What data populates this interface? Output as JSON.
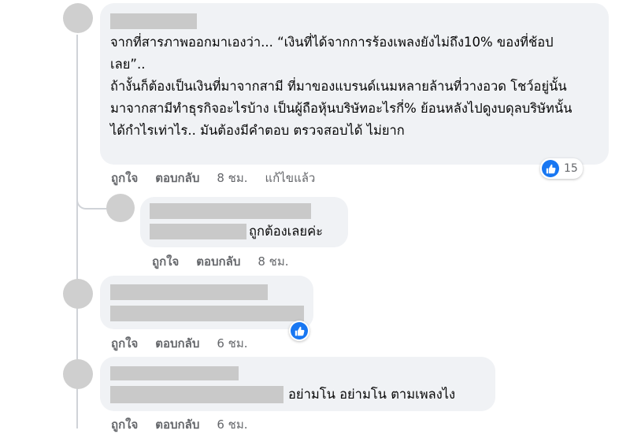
{
  "comments": [
    {
      "text": "จากที่สารภาพออกมาเองว่า... “เงินที่ได้จากการร้องเพลงยังไม่ถึง10% ของที่ช้อปเลย”..\nถ้างั้นก็ต้องเป็นเงินที่มาจากสามี ที่มาของแบรนด์เนมหลายล้านที่วางอวด โชว์อยู่นั้น มาจากสามีทำธุรกิจอะไรบ้าง เป็นผู้ถือหุ้นบริษัทอะไรกี่% ย้อนหลังไปดูงบดุลบริษัทนั้นได้กำไรเท่าไร.. มันต้องมีคำตอบ ตรวจสอบได้ ไม่ยาก",
      "like": "ถูกใจ",
      "reply": "ตอบกลับ",
      "time": "8 ชม.",
      "edited": "แก้ไขแล้ว",
      "reactions": "15"
    },
    {
      "text": "ถูกต้องเลยค่ะ",
      "like": "ถูกใจ",
      "reply": "ตอบกลับ",
      "time": "8 ชม."
    },
    {
      "text": "",
      "like": "ถูกใจ",
      "reply": "ตอบกลับ",
      "time": "6 ชม."
    },
    {
      "text": "อย่ามโน อย่ามโน ตามเพลงไง",
      "like": "ถูกใจ",
      "reply": "ตอบกลับ",
      "time": "6 ชม."
    }
  ],
  "icons": {
    "reaction": "like-thumbs-up-icon"
  },
  "colors": {
    "like_blue": "#1877f2",
    "bubble": "#f0f2f5",
    "meta": "#65676b",
    "redaction": "#c9c9c9"
  }
}
